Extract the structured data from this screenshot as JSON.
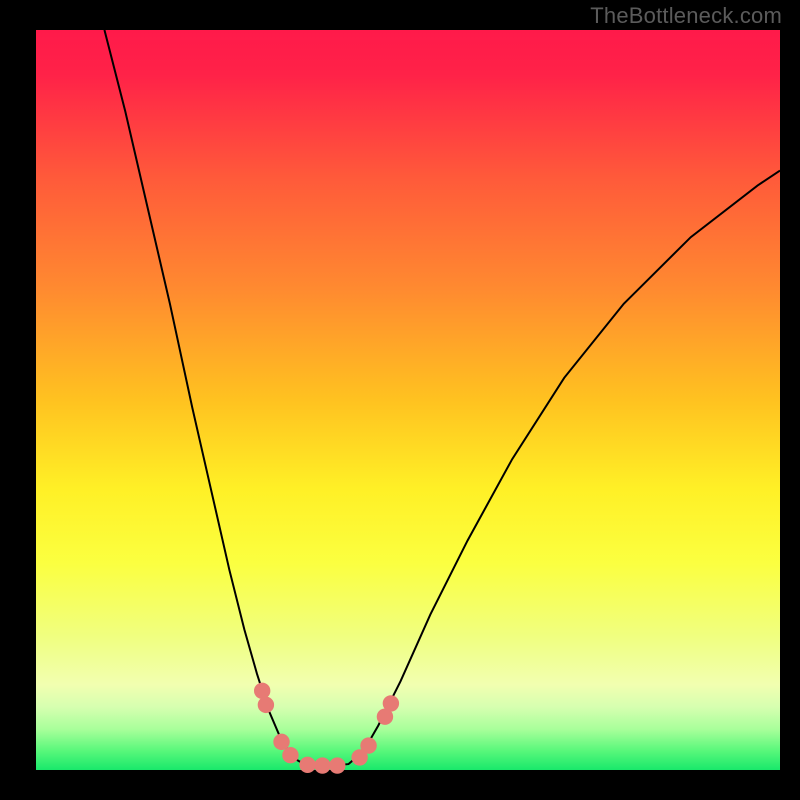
{
  "watermark": {
    "text": "TheBottleneck.com"
  },
  "colors": {
    "bg_black": "#000000",
    "curve_stroke": "#000000",
    "dots_fill": "#e77a74",
    "watermark": "#5b5b5b",
    "gradient_stops": [
      {
        "offset": 0.0,
        "color": "#ff1a4a"
      },
      {
        "offset": 0.06,
        "color": "#ff2248"
      },
      {
        "offset": 0.2,
        "color": "#ff5a3a"
      },
      {
        "offset": 0.35,
        "color": "#ff8a30"
      },
      {
        "offset": 0.5,
        "color": "#ffc220"
      },
      {
        "offset": 0.62,
        "color": "#fff026"
      },
      {
        "offset": 0.72,
        "color": "#fbff40"
      },
      {
        "offset": 0.82,
        "color": "#f0ff80"
      },
      {
        "offset": 0.885,
        "color": "#f1ffb0"
      },
      {
        "offset": 0.915,
        "color": "#d6ffb0"
      },
      {
        "offset": 0.945,
        "color": "#a8ff9a"
      },
      {
        "offset": 0.975,
        "color": "#56f77a"
      },
      {
        "offset": 1.0,
        "color": "#19e86b"
      }
    ]
  },
  "chart_data": {
    "type": "line",
    "title": "",
    "xlabel": "",
    "ylabel": "",
    "x_range": [
      0,
      100
    ],
    "y_range": [
      0,
      100
    ],
    "note": "Curve coordinates are read off the plot area as percentages of width (x) and height-from-top (y).",
    "curve_left": [
      {
        "x": 9.2,
        "y": 0.0
      },
      {
        "x": 12.0,
        "y": 11.0
      },
      {
        "x": 15.0,
        "y": 24.0
      },
      {
        "x": 18.0,
        "y": 37.0
      },
      {
        "x": 21.0,
        "y": 51.0
      },
      {
        "x": 23.5,
        "y": 62.0
      },
      {
        "x": 26.0,
        "y": 73.0
      },
      {
        "x": 28.0,
        "y": 81.0
      },
      {
        "x": 29.7,
        "y": 87.0
      },
      {
        "x": 31.3,
        "y": 92.0
      },
      {
        "x": 33.0,
        "y": 96.0
      },
      {
        "x": 34.5,
        "y": 98.3
      },
      {
        "x": 36.0,
        "y": 99.2
      }
    ],
    "curve_bottom": [
      {
        "x": 36.0,
        "y": 99.2
      },
      {
        "x": 38.0,
        "y": 99.4
      },
      {
        "x": 40.0,
        "y": 99.4
      },
      {
        "x": 42.0,
        "y": 99.2
      }
    ],
    "curve_right": [
      {
        "x": 42.0,
        "y": 99.2
      },
      {
        "x": 44.0,
        "y": 97.5
      },
      {
        "x": 46.0,
        "y": 94.0
      },
      {
        "x": 49.0,
        "y": 88.0
      },
      {
        "x": 53.0,
        "y": 79.0
      },
      {
        "x": 58.0,
        "y": 69.0
      },
      {
        "x": 64.0,
        "y": 58.0
      },
      {
        "x": 71.0,
        "y": 47.0
      },
      {
        "x": 79.0,
        "y": 37.0
      },
      {
        "x": 88.0,
        "y": 28.0
      },
      {
        "x": 97.0,
        "y": 21.0
      },
      {
        "x": 100.0,
        "y": 19.0
      }
    ],
    "dots": [
      {
        "x": 30.4,
        "y": 89.3
      },
      {
        "x": 30.9,
        "y": 91.2
      },
      {
        "x": 33.0,
        "y": 96.2
      },
      {
        "x": 34.2,
        "y": 98.0
      },
      {
        "x": 36.5,
        "y": 99.3
      },
      {
        "x": 38.5,
        "y": 99.4
      },
      {
        "x": 40.5,
        "y": 99.4
      },
      {
        "x": 43.5,
        "y": 98.3
      },
      {
        "x": 44.7,
        "y": 96.7
      },
      {
        "x": 46.9,
        "y": 92.8
      },
      {
        "x": 47.7,
        "y": 91.0
      }
    ]
  }
}
